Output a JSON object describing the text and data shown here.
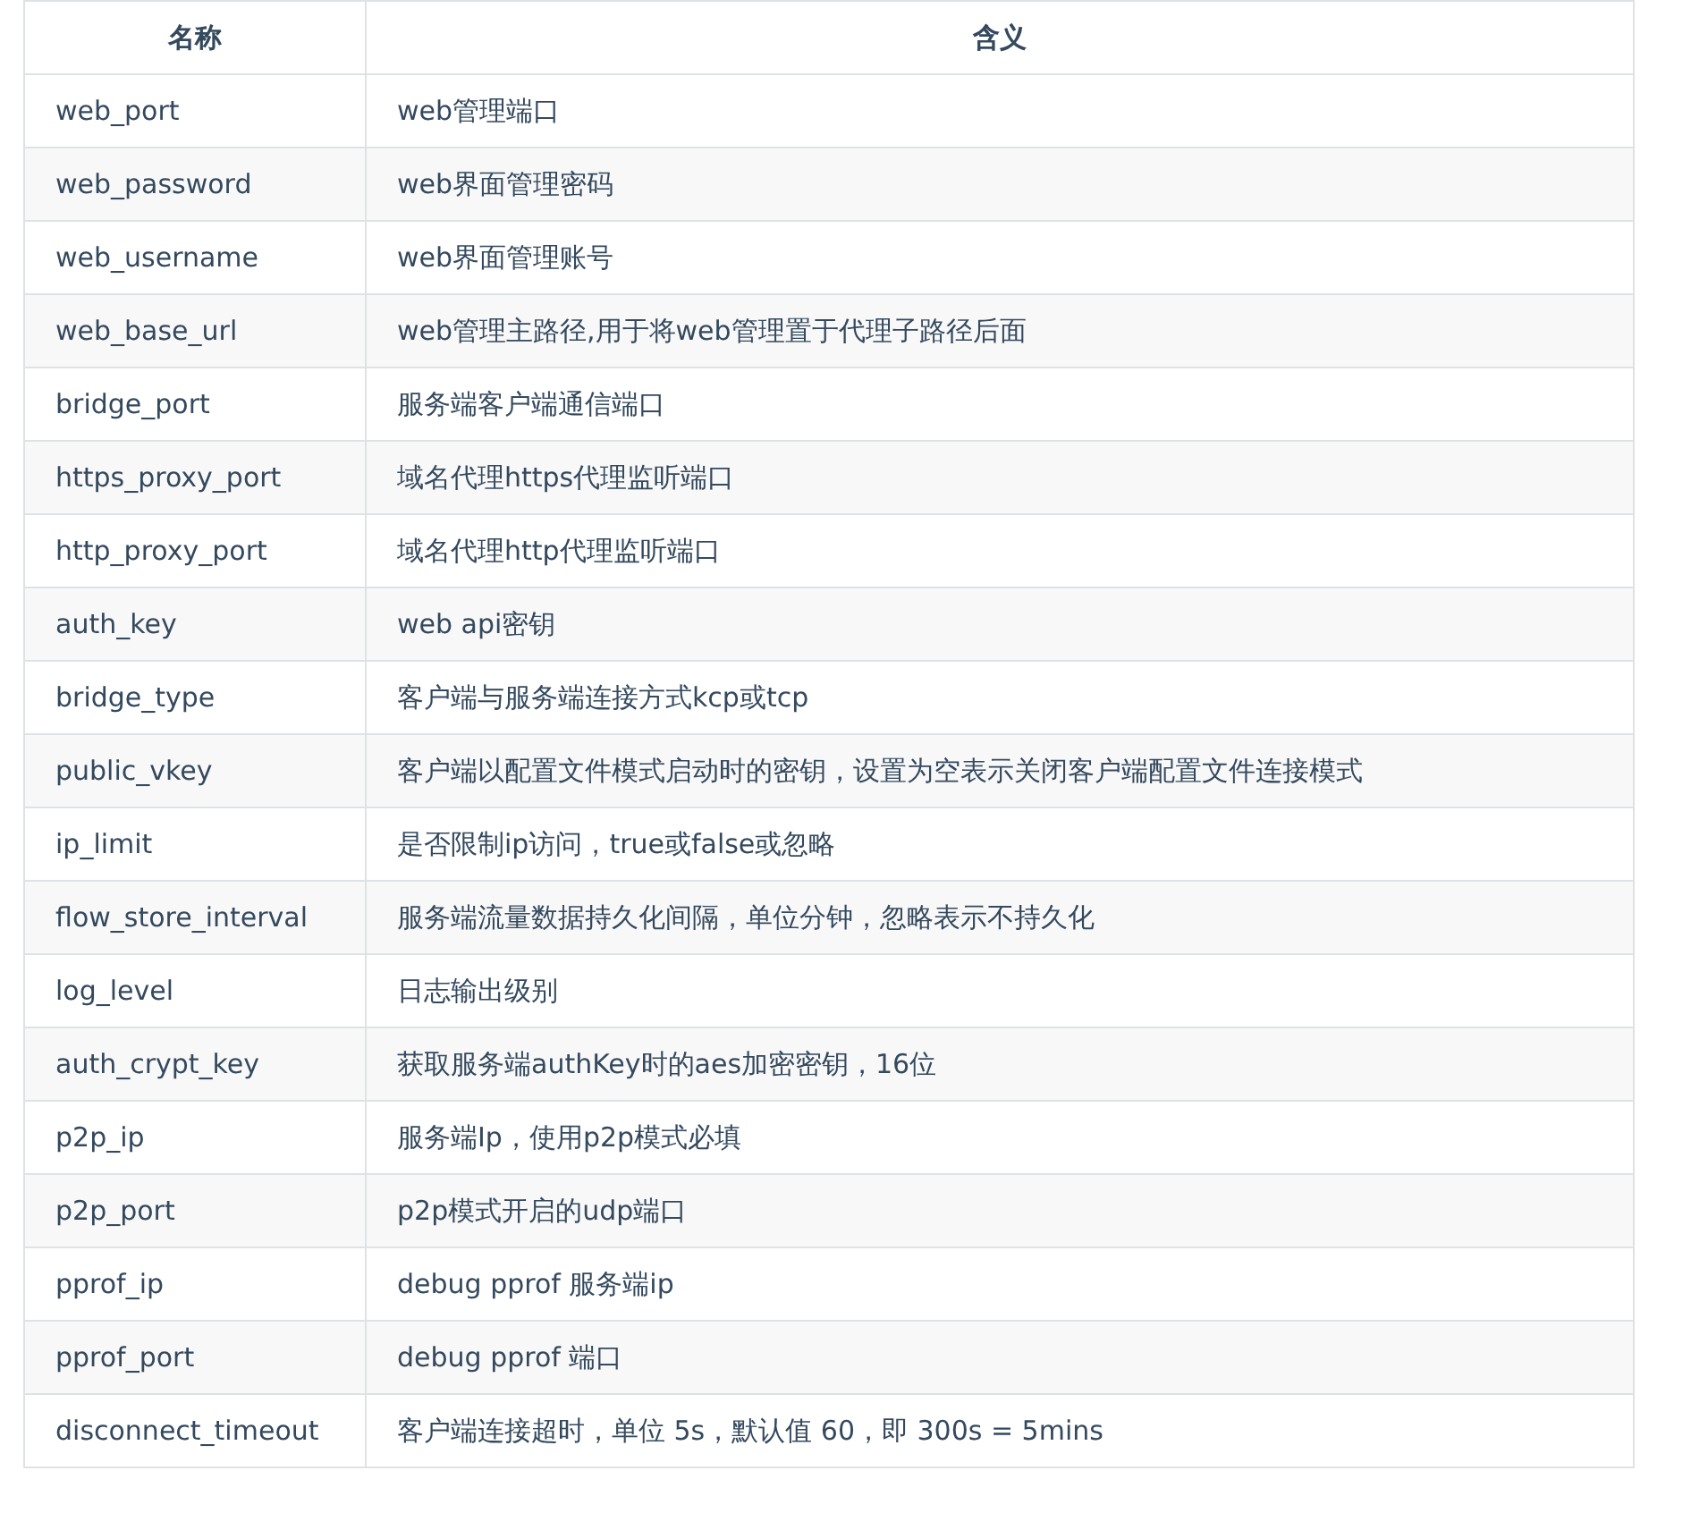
{
  "table": {
    "columns": [
      "名称",
      "含义"
    ],
    "rows": [
      [
        "web_port",
        "web管理端口"
      ],
      [
        "web_password",
        "web界面管理密码"
      ],
      [
        "web_username",
        "web界面管理账号"
      ],
      [
        "web_base_url",
        "web管理主路径,用于将web管理置于代理子路径后面"
      ],
      [
        "bridge_port",
        "服务端客户端通信端口"
      ],
      [
        "https_proxy_port",
        "域名代理https代理监听端口"
      ],
      [
        "http_proxy_port",
        "域名代理http代理监听端口"
      ],
      [
        "auth_key",
        "web api密钥"
      ],
      [
        "bridge_type",
        "客户端与服务端连接方式kcp或tcp"
      ],
      [
        "public_vkey",
        "客户端以配置文件模式启动时的密钥，设置为空表示关闭客户端配置文件连接模式"
      ],
      [
        "ip_limit",
        "是否限制ip访问，true或false或忽略"
      ],
      [
        "flow_store_interval",
        "服务端流量数据持久化间隔，单位分钟，忽略表示不持久化"
      ],
      [
        "log_level",
        "日志输出级别"
      ],
      [
        "auth_crypt_key",
        "获取服务端authKey时的aes加密密钥，16位"
      ],
      [
        "p2p_ip",
        "服务端Ip，使用p2p模式必填"
      ],
      [
        "p2p_port",
        "p2p模式开启的udp端口"
      ],
      [
        "pprof_ip",
        "debug pprof 服务端ip"
      ],
      [
        "pprof_port",
        "debug pprof 端口"
      ],
      [
        "disconnect_timeout",
        "客户端连接超时，单位 5s，默认值 60，即 300s = 5mins"
      ]
    ]
  }
}
